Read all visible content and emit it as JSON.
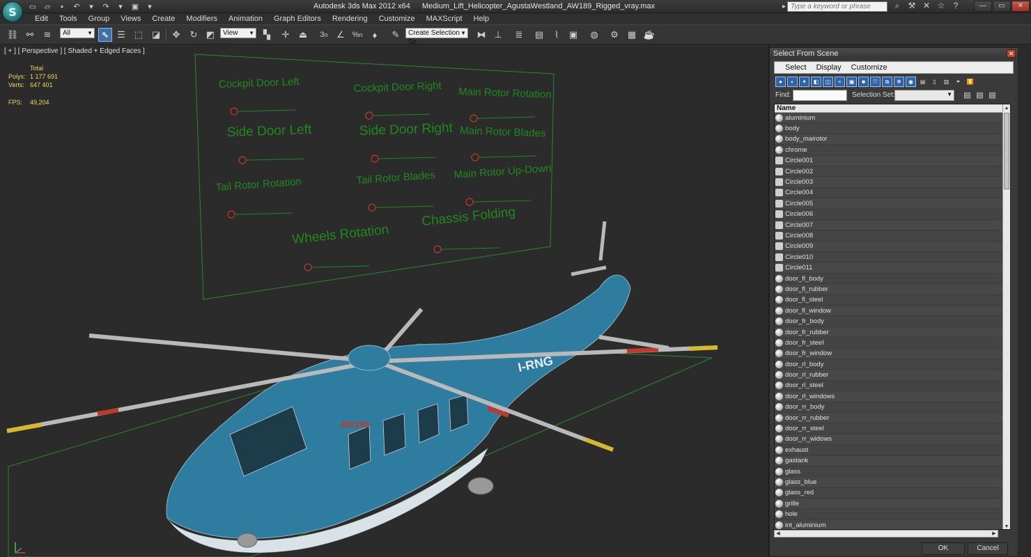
{
  "app": {
    "title": "Autodesk 3ds Max  2012 x64",
    "filename": "Medium_Lift_Helicopter_AgustaWestland_AW189_Rigged_vray.max",
    "logo_letter": "S",
    "help_search_placeholder": "Type a keyword or phrase"
  },
  "menu": [
    "Edit",
    "Tools",
    "Group",
    "Views",
    "Create",
    "Modifiers",
    "Animation",
    "Graph Editors",
    "Rendering",
    "Customize",
    "MAXScript",
    "Help"
  ],
  "toolbar": {
    "selection_filter": "All",
    "ref_coord": "View",
    "named_selection_set": "Create Selection Se",
    "snap_label": "3",
    "angle_snap_label": "%"
  },
  "viewport": {
    "label": "[ + ] [ Perspective ] [ Shaded + Edged Faces ]",
    "stats": {
      "total_label": "Total",
      "polys_label": "Polys:",
      "polys": "1 177 691",
      "verts_label": "Verts:",
      "verts": "647 401",
      "fps_label": "FPS:",
      "fps": "49,204"
    },
    "rig_controls": [
      "Cockpit Door Left",
      "Cockpit Door Right",
      "Main Rotor Rotation",
      "Side Door Left",
      "Side Door Right",
      "Main Rotor Blades",
      "Tail Rotor Rotation",
      "Tail Rotor Blades",
      "Main Rotor Up-Down",
      "Wheels Rotation",
      "Chassis Folding"
    ],
    "heli_registration": "I-RNG",
    "heli_model": "AW189",
    "colors": {
      "rig_text": "#1e8a1e",
      "heli_body": "#2e7ca0",
      "grid": "#2a8a2a"
    }
  },
  "select_panel": {
    "title": "Select From Scene",
    "menu": [
      "Select",
      "Display",
      "Customize"
    ],
    "find_label": "Find:",
    "selection_set_label": "Selection Set:",
    "column_header": "Name",
    "items": [
      "aluminium",
      "body",
      "body_mairotor",
      "chrome",
      "Circle001",
      "Circle002",
      "Circle003",
      "Circle004",
      "Circle005",
      "Circle006",
      "Circle007",
      "Circle008",
      "Circle009",
      "Circle010",
      "Circle011",
      "door_fl_body",
      "door_fl_rubber",
      "door_fl_steel",
      "door_fl_window",
      "door_fr_body",
      "door_fr_rubber",
      "door_fr_steel",
      "door_fr_window",
      "door_rl_body",
      "door_rl_rubber",
      "door_rl_steel",
      "door_rl_windows",
      "door_rr_body",
      "door_rr_rubber",
      "door_rr_steel",
      "door_rr_widows",
      "exhaust",
      "gastank",
      "glass",
      "glass_blue",
      "glass_red",
      "grille",
      "hole",
      "int_aluminium"
    ],
    "ok_label": "OK",
    "cancel_label": "Cancel"
  }
}
